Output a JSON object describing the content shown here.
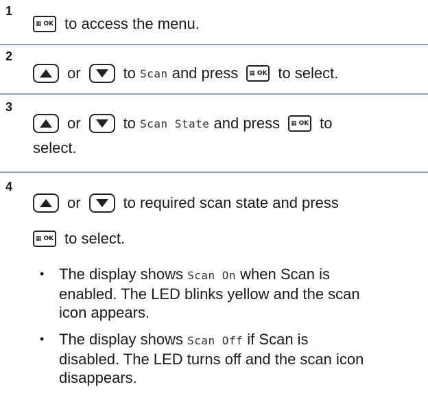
{
  "steps": [
    {
      "number": "1",
      "parts": {
        "after_ok": "to access the menu."
      }
    },
    {
      "number": "2",
      "parts": {
        "or": "or",
        "to": "to",
        "item": "Scan",
        "press": "and press",
        "select": "to select."
      }
    },
    {
      "number": "3",
      "parts": {
        "or": "or",
        "to": "to",
        "item": "Scan State",
        "press": "and press",
        "to2": "to",
        "select2": "select."
      }
    },
    {
      "number": "4",
      "parts": {
        "or": "or",
        "rest": "to required scan state and press",
        "select": "to select."
      }
    }
  ],
  "ok_button_label": "OK",
  "bullets": [
    {
      "pre": "The display shows",
      "code": "Scan On",
      "post1": "when Scan is",
      "line2": "enabled. The LED blinks yellow and the scan",
      "line3": "icon appears."
    },
    {
      "pre": "The display shows",
      "code": "Scan Off",
      "post1": "if Scan is",
      "line2": "disabled. The LED turns off and the scan icon",
      "line3": "disappears."
    }
  ],
  "bullet_symbol": "•",
  "colors": {
    "divider": "#8fa2b8",
    "text": "#1a1a1a"
  }
}
